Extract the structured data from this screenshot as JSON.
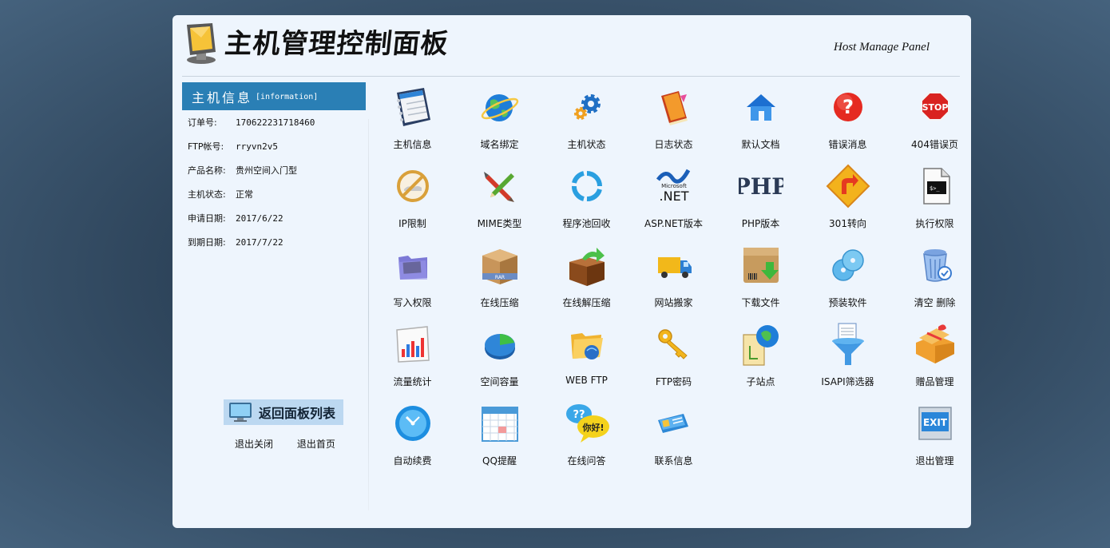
{
  "header": {
    "title": "主机管理控制面板",
    "subtitle": "Host Manage Panel"
  },
  "sidebar": {
    "heading": "主机信息",
    "heading_sub": "[information]",
    "rows": [
      {
        "label": "订单号:",
        "value": "170622231718460"
      },
      {
        "label": "FTP帐号:",
        "value": "rryvn2v5"
      },
      {
        "label": "产品名称:",
        "value": "贵州空间入门型"
      },
      {
        "label": "主机状态:",
        "value": "正常"
      },
      {
        "label": "申请日期:",
        "value": "2017/6/22"
      },
      {
        "label": "到期日期:",
        "value": "2017/7/22"
      }
    ],
    "back_button": "返回面板列表",
    "logout_close": "退出关闭",
    "logout_home": "退出首页"
  },
  "grid": {
    "items": [
      {
        "label": "主机信息",
        "icon": "notebook-icon"
      },
      {
        "label": "域名绑定",
        "icon": "globe-icon"
      },
      {
        "label": "主机状态",
        "icon": "gears-icon"
      },
      {
        "label": "日志状态",
        "icon": "log-book-icon"
      },
      {
        "label": "默认文档",
        "icon": "home-icon"
      },
      {
        "label": "错误消息",
        "icon": "question-icon"
      },
      {
        "label": "404错误页",
        "icon": "stop-sign-icon"
      },
      {
        "label": "IP限制",
        "icon": "no-entry-icon"
      },
      {
        "label": "MIME类型",
        "icon": "brush-pencil-icon"
      },
      {
        "label": "程序池回收",
        "icon": "recycle-icon"
      },
      {
        "label": "ASP.NET版本",
        "icon": "dotnet-icon"
      },
      {
        "label": "PHP版本",
        "icon": "php-icon"
      },
      {
        "label": "301转向",
        "icon": "redirect-sign-icon"
      },
      {
        "label": "执行权限",
        "icon": "terminal-file-icon"
      },
      {
        "label": "写入权限",
        "icon": "folder-terminal-icon"
      },
      {
        "label": "在线压缩",
        "icon": "rar-box-icon"
      },
      {
        "label": "在线解压缩",
        "icon": "box-arrow-icon"
      },
      {
        "label": "网站搬家",
        "icon": "truck-icon"
      },
      {
        "label": "下载文件",
        "icon": "download-box-icon"
      },
      {
        "label": "预装软件",
        "icon": "discs-icon"
      },
      {
        "label": "清空 删除",
        "icon": "trash-icon"
      },
      {
        "label": "流量统计",
        "icon": "bar-chart-icon"
      },
      {
        "label": "空间容量",
        "icon": "pie-chart-icon"
      },
      {
        "label": "WEB FTP",
        "icon": "web-folder-icon"
      },
      {
        "label": "FTP密码",
        "icon": "key-icon"
      },
      {
        "label": "子站点",
        "icon": "globe-document-icon"
      },
      {
        "label": "ISAPI筛选器",
        "icon": "funnel-icon"
      },
      {
        "label": "赠品管理",
        "icon": "gift-box-icon"
      },
      {
        "label": "自动续费",
        "icon": "clock-icon"
      },
      {
        "label": "QQ提醒",
        "icon": "calendar-icon"
      },
      {
        "label": "在线问答",
        "icon": "chat-bubbles-icon"
      },
      {
        "label": "联系信息",
        "icon": "contact-card-icon"
      },
      {
        "label": "退出管理",
        "icon": "exit-sign-icon"
      }
    ],
    "bubble_text": "你好!",
    "stop_text": "STOP",
    "php_text": "PHP",
    "net_text": ".NET",
    "net_small": "Microsoft",
    "rar_text": "RAR",
    "exit_text": "EXIT"
  }
}
